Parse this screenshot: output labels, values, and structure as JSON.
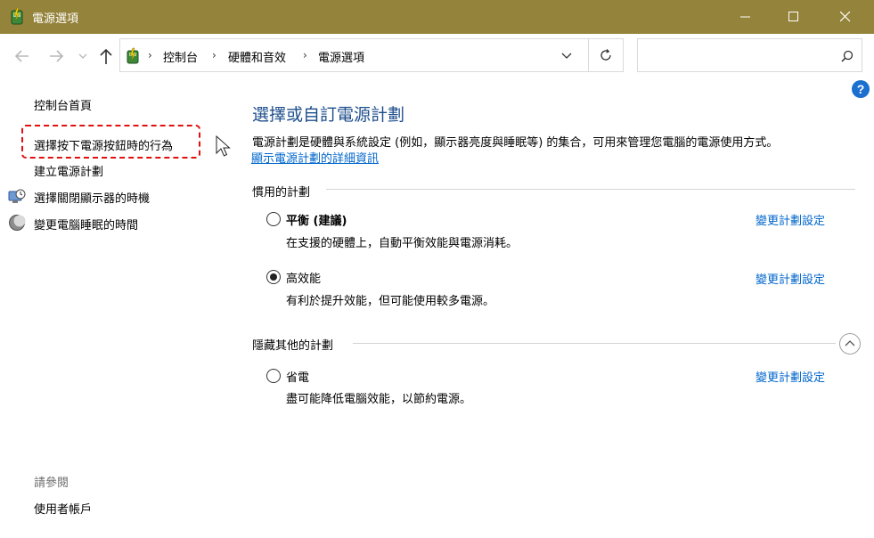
{
  "window": {
    "title": "電源選項",
    "titlebar_color": "#94833a"
  },
  "address": {
    "breadcrumbs": [
      "控制台",
      "硬體和音效",
      "電源選項"
    ],
    "search_placeholder": ""
  },
  "sidebar": {
    "home": "控制台首頁",
    "items": [
      {
        "label": "選擇按下電源按鈕時的行為",
        "icon": "none"
      },
      {
        "label": "建立電源計劃",
        "icon": "none"
      },
      {
        "label": "選擇關閉顯示器的時機",
        "icon": "monitor-clock-icon"
      },
      {
        "label": "變更電腦睡眠的時間",
        "icon": "moon-icon"
      }
    ],
    "see_also_label": "請參閱",
    "see_also_items": [
      "使用者帳戶"
    ]
  },
  "main": {
    "title": "選擇或自訂電源計劃",
    "description": "電源計劃是硬體與系統設定 (例如，顯示器亮度與睡眠等) 的集合，可用來管理您電腦的電源使用方式。",
    "details_link": "顯示電源計劃的詳細資訊",
    "preferred_group": "慣用的計劃",
    "hidden_group": "隱藏其他的計劃",
    "change_label": "變更計劃設定",
    "plans": [
      {
        "name": "平衡 (建議)",
        "desc": "在支援的硬體上，自動平衡效能與電源消耗。",
        "selected": false
      },
      {
        "name": "高效能",
        "desc": "有利於提升效能，但可能使用較多電源。",
        "selected": true
      },
      {
        "name": "省電",
        "desc": "盡可能降低電腦效能，以節約電源。",
        "selected": false
      }
    ]
  },
  "colors": {
    "link": "#0066cc",
    "heading": "#1e4e8c",
    "highlight": "#e01010"
  }
}
